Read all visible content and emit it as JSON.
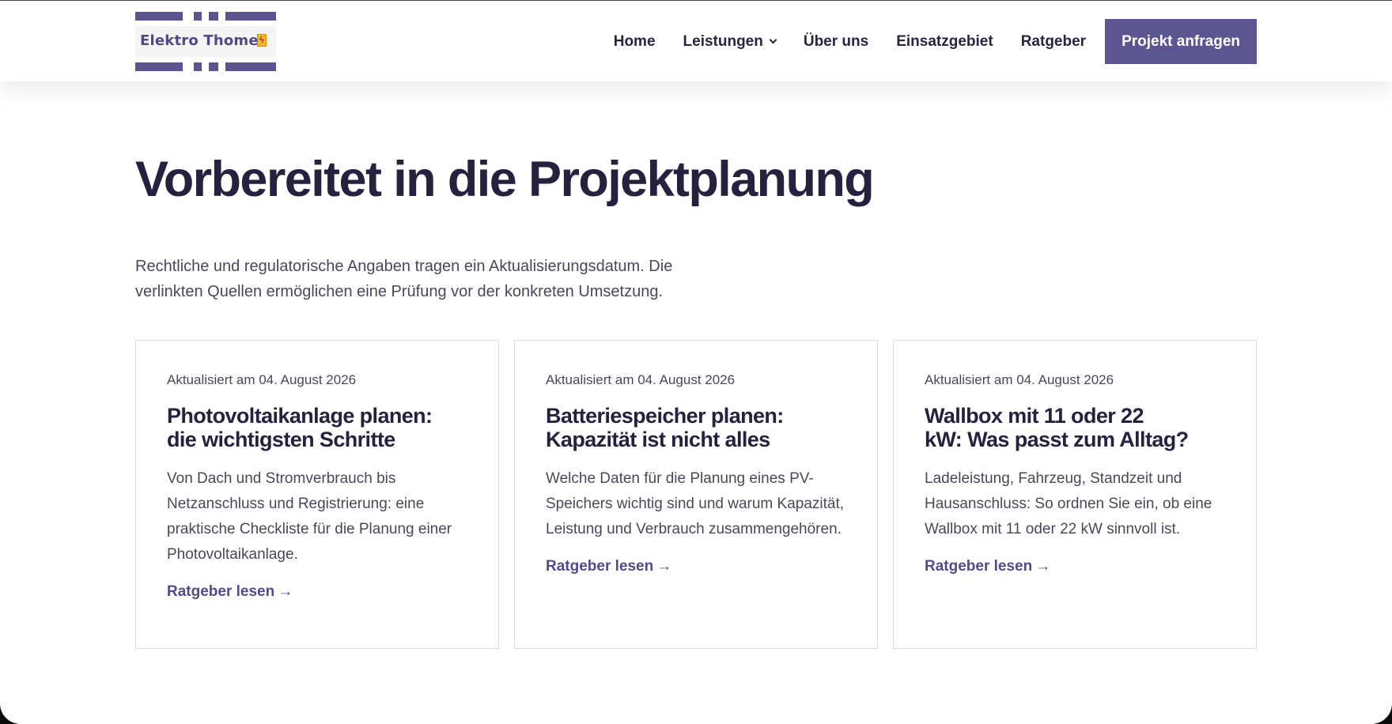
{
  "brand": {
    "logo_text": "Elektro Thome",
    "accent": "#5c5592",
    "text_dark": "#25223f"
  },
  "nav": {
    "items": [
      {
        "label": "Home"
      },
      {
        "label": "Leistungen",
        "has_dropdown": true
      },
      {
        "label": "Über uns"
      },
      {
        "label": "Einsatzgebiet"
      },
      {
        "label": "Ratgeber"
      }
    ],
    "cta_label": "Projekt anfragen"
  },
  "main": {
    "title": "Vorbereitet in die Projektplanung",
    "intro_line1": "Rechtliche und regulatorische Angaben tragen ein Aktualisierungsdatum. Die",
    "intro_line2": "verlinkten Quellen ermöglichen eine Prüfung vor der konkreten Umsetzung.",
    "cards": [
      {
        "date": "Aktualisiert am 04. August 2026",
        "title_line1": "Photovoltaikanlage planen:",
        "title_line2": "die wichtigsten Schritte",
        "text": "Von Dach und Stromverbrauch bis Netzanschluss und Registrierung: eine praktische Checkliste für die Planung einer Photovoltaikanlage.",
        "link_label": "Ratgeber lesen",
        "link_arrow": "→"
      },
      {
        "date": "Aktualisiert am 04. August 2026",
        "title_line1": "Batteriespeicher planen:",
        "title_line2": "Kapazität ist nicht alles",
        "text": "Welche Daten für die Planung eines PV-Speichers wichtig sind und warum Kapazität, Leistung und Verbrauch zusammengehören.",
        "link_label": "Ratgeber lesen",
        "link_arrow": "→"
      },
      {
        "date": "Aktualisiert am 04. August 2026",
        "title_line1": "Wallbox mit 11 oder 22",
        "title_line2": "kW: Was passt zum Alltag?",
        "text": "Ladeleistung, Fahrzeug, Standzeit und Hausanschluss: So ordnen Sie ein, ob eine Wallbox mit 11 oder 22 kW sinnvoll ist.",
        "link_label": "Ratgeber lesen",
        "link_arrow": "→"
      }
    ]
  }
}
